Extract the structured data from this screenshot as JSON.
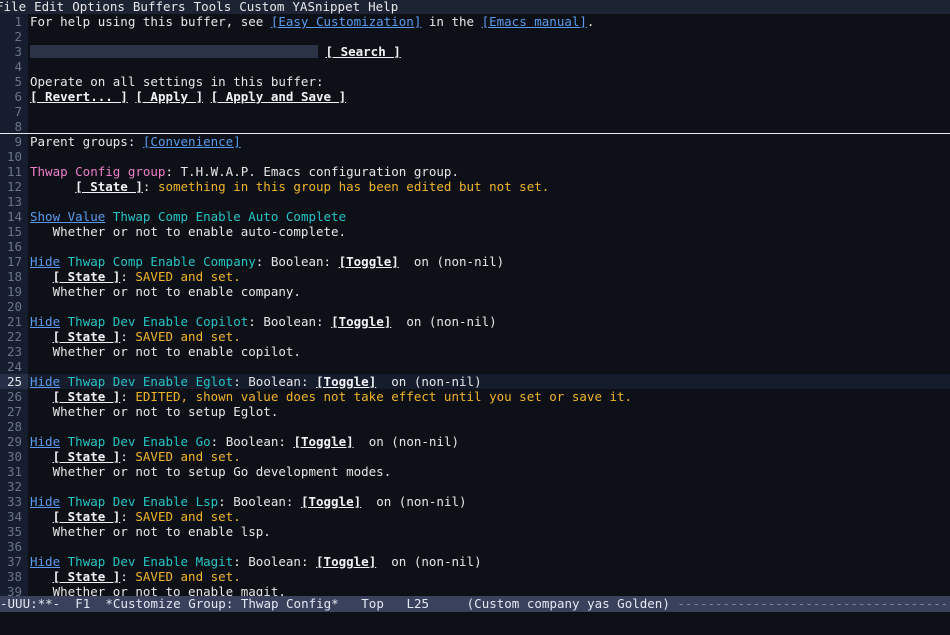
{
  "menubar": {
    "items": [
      "File",
      "Edit",
      "Options",
      "Buffers",
      "Tools",
      "Custom",
      "YASnippet",
      "Help"
    ]
  },
  "colors": {
    "background": "#0d1117",
    "gutter_bg": "#161d2e",
    "gutter_fg": "#6b7489",
    "link": "#5a9bf0",
    "group_name": "#f07ecb",
    "variable_name": "#25c4c4",
    "state_text": "#f0b429",
    "modeline_bg": "#39415c",
    "menubar_bg": "#1c2333",
    "search_field_bg": "#2b3347",
    "current_line_number": "#dfe3ec"
  },
  "buffer": {
    "help_line": {
      "prefix": "For help using this buffer, see ",
      "link1": "[Easy Customization]",
      "middle": " in the ",
      "link2": "[Emacs manual]",
      "suffix": "."
    },
    "search": {
      "field_value": "",
      "field_placeholder": "",
      "button_label": "[ Search ]"
    },
    "operate_label": "Operate on all settings in this buffer:",
    "operate_buttons": [
      "[ Revert... ]",
      "[ Apply ]",
      "[ Apply and Save ]"
    ],
    "parent_groups": {
      "label": "Parent groups: ",
      "link": "[Convenience]"
    },
    "group": {
      "name": "Thwap Config group",
      "separator": ": ",
      "doc": "T.H.W.A.P. Emacs configuration group.",
      "state_button": "[ State ]",
      "state_colon": ": ",
      "state_text": "something in this group has been edited but not set."
    },
    "settings": [
      {
        "line_number": 14,
        "visibility_toggle": "Show Value",
        "name": "Thwap Comp Enable Auto Complete",
        "has_type": false,
        "type_label": "",
        "toggle_label": "",
        "value_label": "",
        "state_button": "",
        "state_colon": "",
        "state_text": "",
        "doc": "Whether or not to enable auto-complete."
      },
      {
        "line_number": 17,
        "visibility_toggle": "Hide",
        "name": "Thwap Comp Enable Company",
        "has_type": true,
        "type_label": ": Boolean: ",
        "toggle_label": "[Toggle]",
        "value_label": "  on (non-nil)",
        "state_button": "[ State ]",
        "state_colon": ": ",
        "state_text": "SAVED and set.",
        "doc": "Whether or not to enable company."
      },
      {
        "line_number": 21,
        "visibility_toggle": "Hide",
        "name": "Thwap Dev Enable Copilot",
        "has_type": true,
        "type_label": ": Boolean: ",
        "toggle_label": "[Toggle]",
        "value_label": "  on (non-nil)",
        "state_button": "[ State ]",
        "state_colon": ": ",
        "state_text": "SAVED and set.",
        "doc": "Whether or not to enable copilot."
      },
      {
        "line_number": 25,
        "visibility_toggle": "Hide",
        "name": "Thwap Dev Enable Eglot",
        "has_type": true,
        "type_label": ": Boolean: ",
        "toggle_label": "[Toggle]",
        "value_label": "  on (non-nil)",
        "state_button": "[ State ]",
        "state_colon": ": ",
        "state_text": "EDITED, shown value does not take effect until you set or save it.",
        "doc": "Whether or not to setup Eglot."
      },
      {
        "line_number": 29,
        "visibility_toggle": "Hide",
        "name": "Thwap Dev Enable Go",
        "has_type": true,
        "type_label": ": Boolean: ",
        "toggle_label": "[Toggle]",
        "value_label": "  on (non-nil)",
        "state_button": "[ State ]",
        "state_colon": ": ",
        "state_text": "SAVED and set.",
        "doc": "Whether or not to setup Go development modes."
      },
      {
        "line_number": 33,
        "visibility_toggle": "Hide",
        "name": "Thwap Dev Enable Lsp",
        "has_type": true,
        "type_label": ": Boolean: ",
        "toggle_label": "[Toggle]",
        "value_label": "  on (non-nil)",
        "state_button": "[ State ]",
        "state_colon": ": ",
        "state_text": "SAVED and set.",
        "doc": "Whether or not to enable lsp."
      },
      {
        "line_number": 37,
        "visibility_toggle": "Hide",
        "name": "Thwap Dev Enable Magit",
        "has_type": true,
        "type_label": ": Boolean: ",
        "toggle_label": "[Toggle]",
        "value_label": "  on (non-nil)",
        "state_button": "[ State ]",
        "state_colon": ": ",
        "state_text": "SAVED and set.",
        "doc": "Whether or not to enable magit."
      }
    ],
    "current_line": 25,
    "line_numbers": [
      1,
      2,
      3,
      4,
      5,
      6,
      7,
      8,
      9,
      10,
      11,
      12,
      13,
      14,
      15,
      16,
      17,
      18,
      19,
      20,
      21,
      22,
      23,
      24,
      25,
      26,
      27,
      28,
      29,
      30,
      31,
      32,
      33,
      34,
      35,
      36,
      37,
      38,
      39
    ]
  },
  "modeline": {
    "mode_indicator": "-UUU:**-",
    "frame_id": "F1",
    "buffer_name": "*Customize Group: Thwap Config*",
    "position": "Top",
    "line_indicator": "L25",
    "major_modes": "(Custom company yas Golden)",
    "filler": "------------------------------------------------------------"
  }
}
